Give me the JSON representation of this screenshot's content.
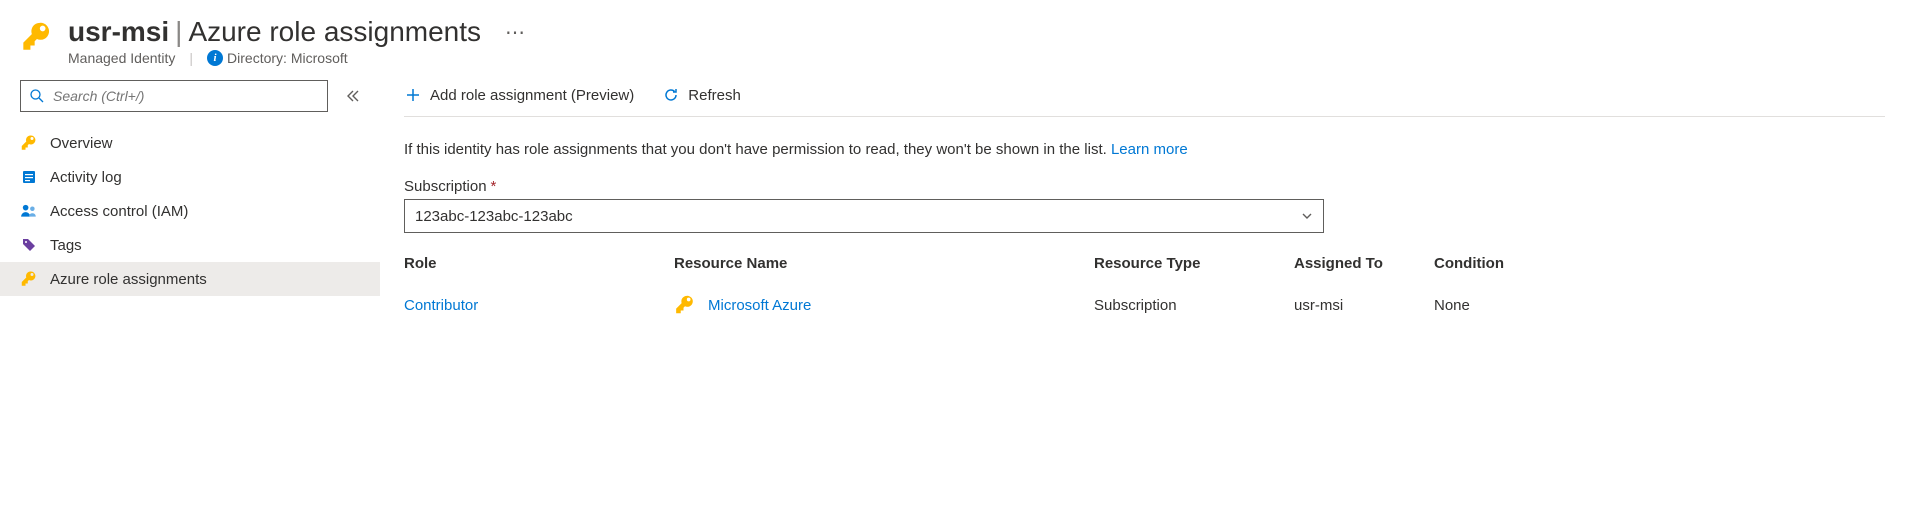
{
  "header": {
    "resource_name": "usr-msi",
    "page_title": "Azure role assignments",
    "resource_type": "Managed Identity",
    "directory_prefix": "Directory:",
    "directory_name": "Microsoft"
  },
  "sidebar": {
    "search_placeholder": "Search (Ctrl+/)",
    "items": [
      {
        "label": "Overview",
        "icon": "key",
        "active": false
      },
      {
        "label": "Activity log",
        "icon": "log",
        "active": false
      },
      {
        "label": "Access control (IAM)",
        "icon": "people",
        "active": false
      },
      {
        "label": "Tags",
        "icon": "tag",
        "active": false
      },
      {
        "label": "Azure role assignments",
        "icon": "key",
        "active": true
      }
    ]
  },
  "toolbar": {
    "add_label": "Add role assignment (Preview)",
    "refresh_label": "Refresh"
  },
  "info": {
    "text": "If this identity has role assignments that you don't have permission to read, they won't be shown in the list.",
    "learn_more": "Learn more"
  },
  "subscription": {
    "label": "Subscription",
    "value": "123abc-123abc-123abc"
  },
  "table": {
    "columns": [
      "Role",
      "Resource Name",
      "Resource Type",
      "Assigned To",
      "Condition"
    ],
    "rows": [
      {
        "role": "Contributor",
        "resource_name": "Microsoft Azure",
        "resource_type": "Subscription",
        "assigned_to": "usr-msi",
        "condition": "None"
      }
    ]
  }
}
